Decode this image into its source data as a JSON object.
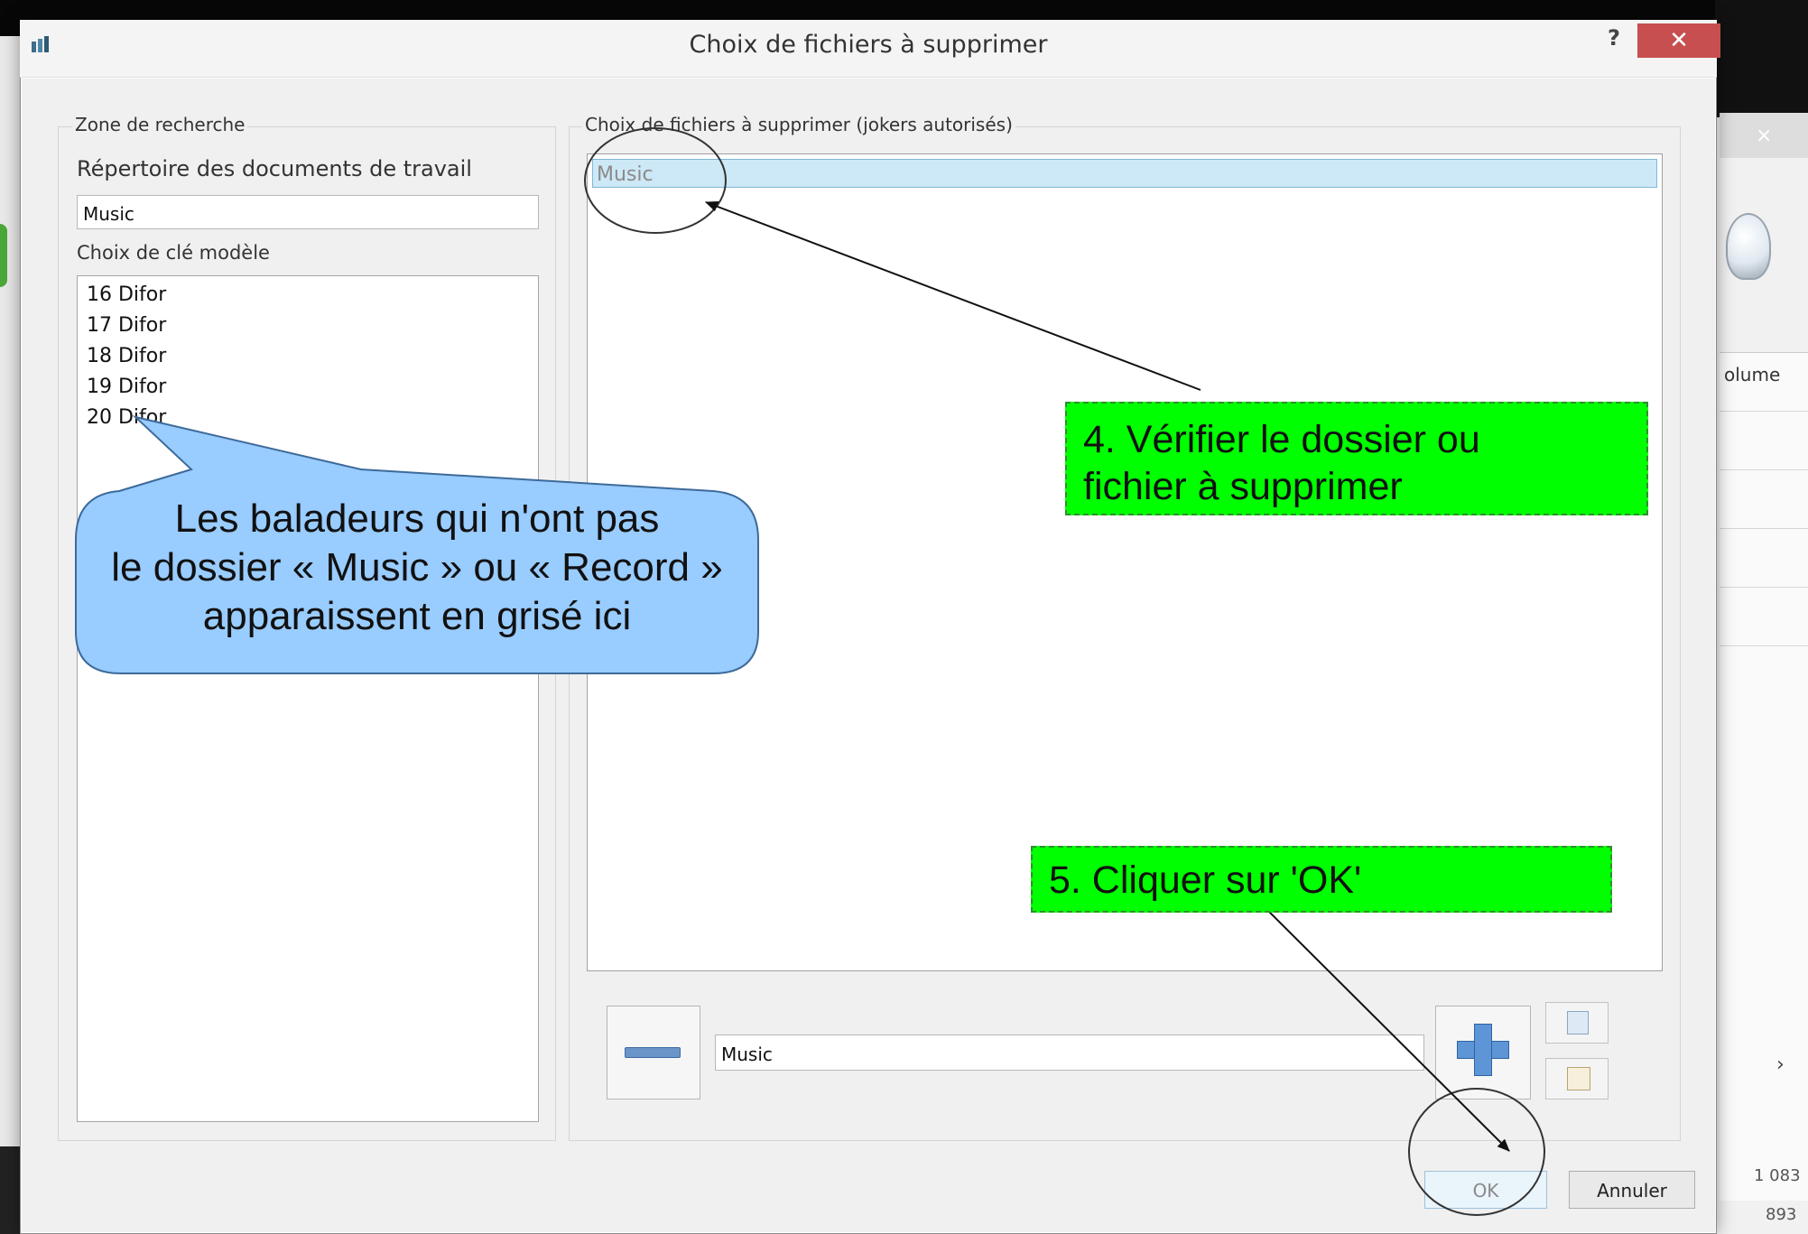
{
  "dialog": {
    "title": "Choix de fichiers à supprimer",
    "help_label": "?",
    "close_label": "✕",
    "ok_label": "OK",
    "cancel_label": "Annuler"
  },
  "search_zone": {
    "caption": "Zone de recherche",
    "dir_label": "Répertoire des documents de travail",
    "dir_value": "Music",
    "key_label": "Choix de clé modèle",
    "keys": [
      "16 Difor",
      "17 Difor",
      "18 Difor",
      "19 Difor",
      "20 Difor"
    ]
  },
  "file_choice": {
    "caption": "Choix de fichiers à supprimer (jokers autorisés)",
    "items": [
      "Music"
    ],
    "input_value": "Music"
  },
  "annotations": {
    "step4": "4. Vérifier le dossier ou\nfichier à supprimer",
    "step5": "5. Cliquer sur 'OK'",
    "callout": "Les baladeurs qui n'ont pas\nle dossier « Music » ou « Record »\napparaissent en grisé ici"
  },
  "background": {
    "column_header": "olume",
    "values": [
      "1 083",
      "893"
    ]
  },
  "colors": {
    "annotation_green": "#00ff00",
    "callout_blue": "#99ccff",
    "selection": "#cde8f6",
    "close_red": "#c74f4f"
  }
}
